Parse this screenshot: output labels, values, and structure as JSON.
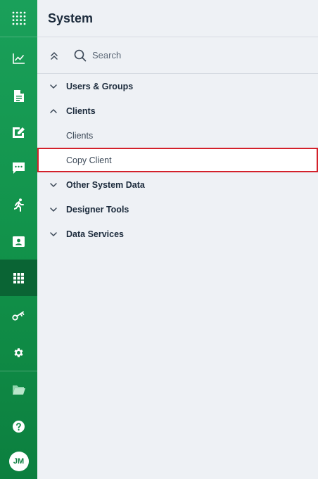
{
  "rail": {
    "top_icon": "app-grid-icon",
    "items": [
      {
        "icon": "analytics-chart-icon"
      },
      {
        "icon": "document-icon"
      },
      {
        "icon": "edit-document-icon"
      },
      {
        "icon": "chat-message-icon"
      },
      {
        "icon": "running-person-icon"
      },
      {
        "icon": "contact-card-icon"
      },
      {
        "icon": "apps-grid-icon",
        "active": true
      },
      {
        "icon": "key-icon"
      },
      {
        "icon": "settings-gear-icon"
      },
      {
        "icon": "folder-icon"
      },
      {
        "icon": "help-icon"
      }
    ],
    "avatar_initials": "JM"
  },
  "panel": {
    "title": "System",
    "search_label": "Search",
    "tree": [
      {
        "label": "Users & Groups",
        "expanded": false
      },
      {
        "label": "Clients",
        "expanded": true,
        "children": [
          "Clients",
          "Copy Client"
        ]
      },
      {
        "label": "Other System Data",
        "expanded": false
      },
      {
        "label": "Designer Tools",
        "expanded": false
      },
      {
        "label": "Data Services",
        "expanded": false
      }
    ],
    "selected_child": "Copy Client"
  },
  "colors": {
    "rail_green": "#119149",
    "rail_active": "#0a6434",
    "panel_bg": "#eef1f5",
    "title_text": "#1c2b3c",
    "selection_border": "#d3212b"
  }
}
